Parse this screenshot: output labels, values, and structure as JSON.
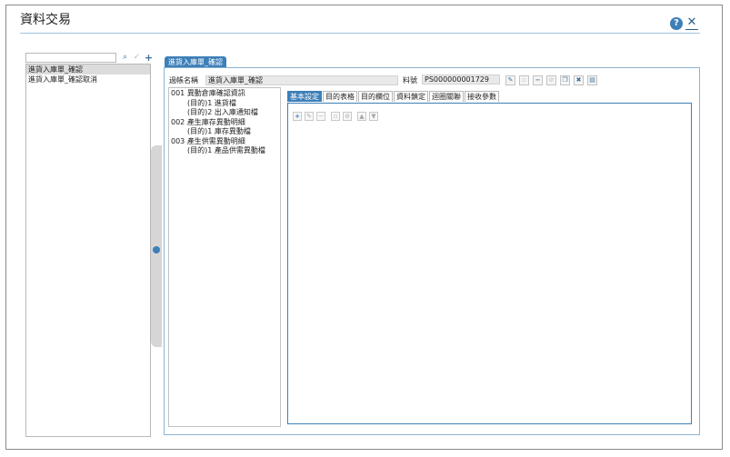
{
  "window": {
    "title": "資料交易",
    "help_icon": "?",
    "close_icon": "✕"
  },
  "left": {
    "search_placeholder": "",
    "items": [
      {
        "label": "進貨入庫單_確認",
        "selected": true
      },
      {
        "label": "進貨入庫單_確認取消",
        "selected": false
      }
    ]
  },
  "main": {
    "tab_label": "進貨入庫單_確認",
    "account_name_label": "過帳名稱",
    "account_name_value": "進貨入庫單_確認",
    "number_label": "料號",
    "number_value": "PS000000001729",
    "tree": [
      {
        "text": "001 異動倉庫確認資訊",
        "level": 0
      },
      {
        "text": "(目的)1 進貨檔",
        "level": 1
      },
      {
        "text": "(目的)2 出入庫通知檔",
        "level": 1
      },
      {
        "text": "002 產生庫存異動明細",
        "level": 0
      },
      {
        "text": "(目的)1 庫存異動檔",
        "level": 1
      },
      {
        "text": "003 產生供需異動明細",
        "level": 0
      },
      {
        "text": "(目的)1 產品供需異動檔",
        "level": 1
      }
    ],
    "subtabs": [
      "基本設定",
      "目的表格",
      "目的欄位",
      "資料鎖定",
      "迴圈關聯",
      "接收參數"
    ],
    "active_subtab": 0
  },
  "colors": {
    "accent": "#3d7fb8",
    "border": "#8bb3d3"
  }
}
